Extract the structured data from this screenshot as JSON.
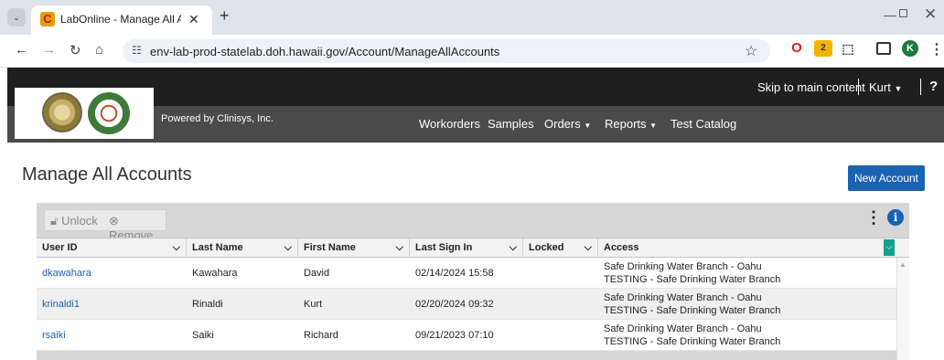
{
  "browser": {
    "tab_title": "LabOnline - Manage All Accoun",
    "tab_favicon": "C",
    "url": "env-lab-prod-statelab.doh.hawaii.gov/Account/ManageAllAccounts",
    "profile_initial": "K",
    "extension_badge": "2"
  },
  "header": {
    "skip_link": "Skip to main content",
    "user": "Kurt",
    "help": "?",
    "powered_by": "Powered by Clinisys, Inc."
  },
  "nav": {
    "workorders": "Workorders",
    "samples": "Samples",
    "orders": "Orders",
    "reports": "Reports",
    "test_catalog": "Test Catalog"
  },
  "page": {
    "title": "Manage All Accounts",
    "new_account": "New Account"
  },
  "grid": {
    "toolbar": {
      "unlock": "Unlock",
      "remove": "Remove"
    },
    "columns": {
      "user_id": "User ID",
      "last_name": "Last Name",
      "first_name": "First Name",
      "last_sign_in": "Last Sign In",
      "locked": "Locked",
      "access": "Access"
    },
    "rows": [
      {
        "user_id": "dkawahara",
        "last_name": "Kawahara",
        "first_name": "David",
        "last_sign_in": "02/14/2024 15:58",
        "locked": "",
        "access_1": "Safe Drinking Water Branch - Oahu",
        "access_2": "TESTING - Safe Drinking Water Branch"
      },
      {
        "user_id": "krinaldi1",
        "last_name": "Rinaldi",
        "first_name": "Kurt",
        "last_sign_in": "02/20/2024 09:32",
        "locked": "",
        "access_1": "Safe Drinking Water Branch - Oahu",
        "access_2": "TESTING - Safe Drinking Water Branch"
      },
      {
        "user_id": "rsaiki",
        "last_name": "Saiki",
        "first_name": "Richard",
        "last_sign_in": "09/21/2023 07:10",
        "locked": "",
        "access_1": "Safe Drinking Water Branch - Oahu",
        "access_2": "TESTING - Safe Drinking Water Branch"
      }
    ]
  },
  "colors": {
    "primary": "#1a62b3",
    "topbar": "#1f1f1f",
    "navbar": "#4a4a4a",
    "accent_teal": "#1aa08a"
  }
}
